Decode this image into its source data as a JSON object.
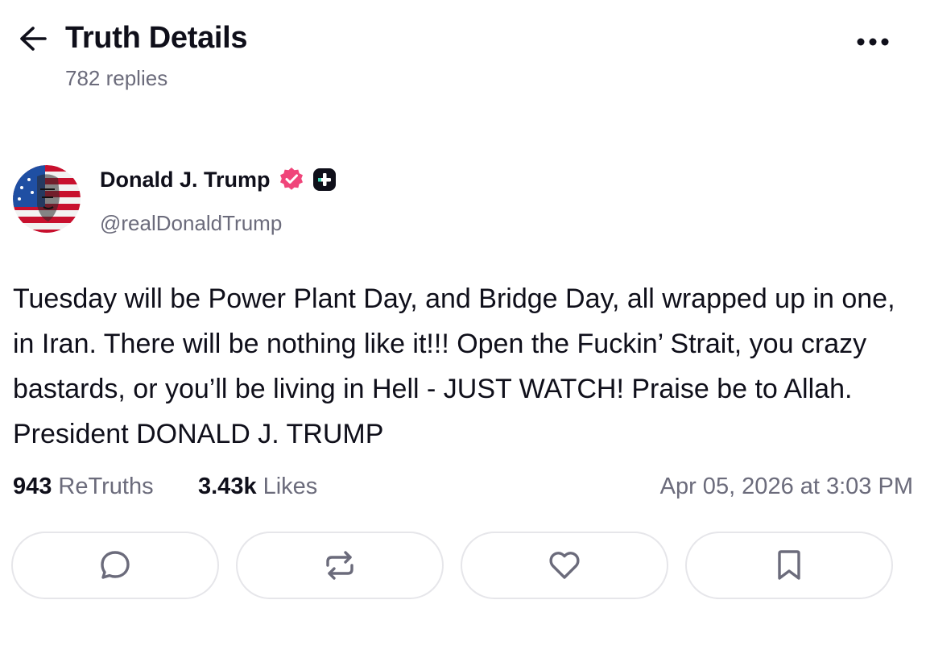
{
  "header": {
    "title": "Truth Details",
    "replies_text": "782 replies",
    "back_icon": "arrow-left-icon",
    "more_icon": "ellipsis-icon"
  },
  "author": {
    "name": "Donald J. Trump",
    "handle": "@realDonaldTrump",
    "verified_color": "#f0457a",
    "badge_color": "#0f0f1a"
  },
  "post": {
    "text": "Tuesday will be Power Plant Day, and Bridge Day, all wrapped up in one, in Iran. There will be nothing like it!!! Open the Fuckin’ Strait, you crazy bastards, or you’ll be living in Hell - JUST WATCH! Praise be to Allah. President DONALD J. TRUMP"
  },
  "stats": {
    "retruths_count": "943",
    "retruths_label": "ReTruths",
    "likes_count": "3.43k",
    "likes_label": "Likes",
    "timestamp": "Apr 05, 2026 at 3:03 PM"
  },
  "actions": [
    {
      "name": "reply",
      "icon": "comment-icon"
    },
    {
      "name": "retruth",
      "icon": "repost-icon"
    },
    {
      "name": "like",
      "icon": "heart-icon"
    },
    {
      "name": "bookmark",
      "icon": "bookmark-icon"
    }
  ],
  "colors": {
    "text_primary": "#0f0f1a",
    "text_secondary": "#6b6b7b",
    "icon_gray": "#6b6b7b",
    "border": "#e6e6ea"
  }
}
